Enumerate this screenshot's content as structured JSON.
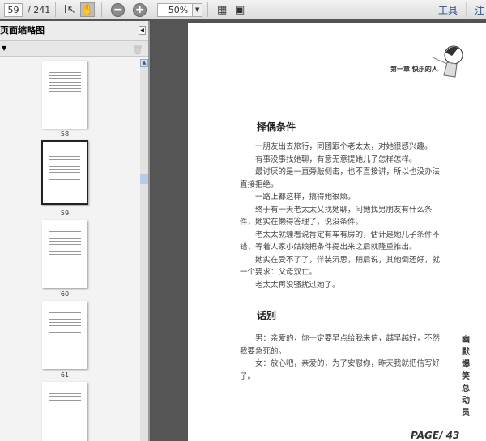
{
  "toolbar": {
    "page": "59",
    "total": "/ 241",
    "zoom": "50%",
    "tools": "工具",
    "comment": "注"
  },
  "panel": {
    "title": "页面缩略图",
    "thumbs": [
      "58",
      "59",
      "60",
      "61"
    ],
    "selected": "59"
  },
  "page": {
    "header": "第一章 快乐的人",
    "sections": [
      {
        "title": "择偶条件",
        "paragraphs": [
          "一朋友出去旅行，同团跟个老太太，对她很感兴趣。",
          "有事没事找她聊，有意无意提她儿子怎样怎样。",
          "最讨厌的是一直旁敲侧击，也不直接讲，所以也没办法直接拒绝。",
          "一路上都这样，搞得她很烦。",
          "终于有一天老太太又找她聊，问她找男朋友有什么条件，她实在懒得答理了，说没条件。",
          "老太太就缠着说肯定有车有房的，估计是她儿子条件不错，等着人家小姑娘把条件提出来之后就隆重推出。",
          "她实在受不了了，佯装沉思，稍后说，其他倒还好，就一个要求：父母双亡。",
          "老太太再没骚扰过她了。"
        ]
      },
      {
        "title": "话别",
        "paragraphs": [
          "男：亲爱的，你一定要早点给我来信，越早越好，不然我要急死的。",
          "女：放心吧，亲爱的，为了安慰你，昨天我就把信写好了。"
        ]
      }
    ],
    "side_title": "幽默爆笑总动员",
    "footer": "PAGE/ 43"
  }
}
